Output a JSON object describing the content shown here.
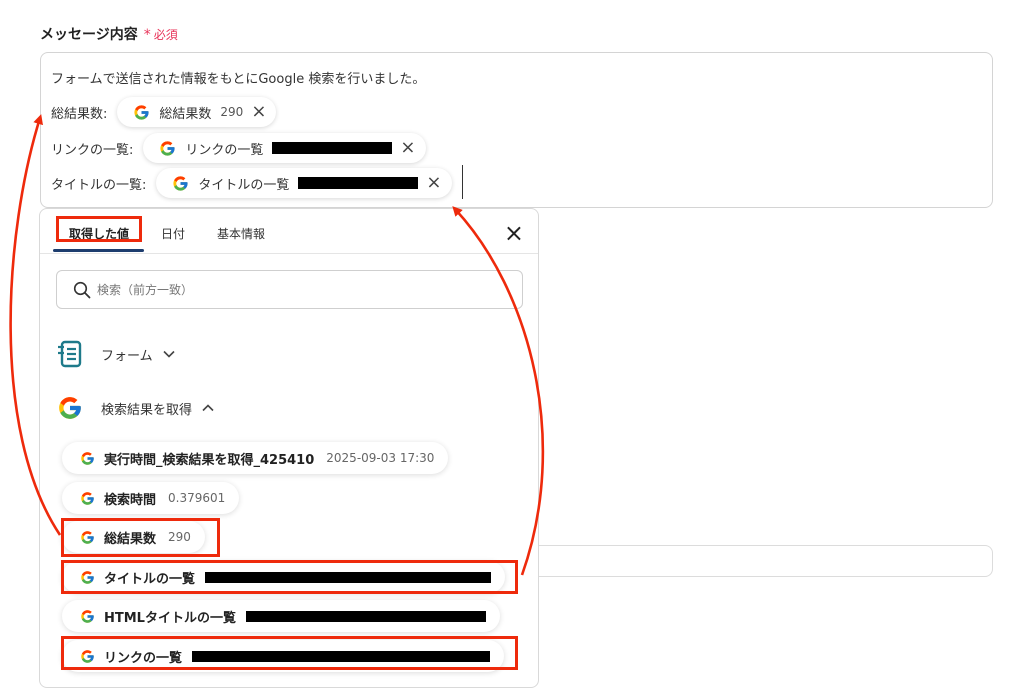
{
  "field": {
    "label": "メッセージ内容",
    "required_mark": "*",
    "required_text": "必須"
  },
  "message": {
    "line1": "フォームで送信された情報をもとにGoogle 検索を行いました。",
    "rows": [
      {
        "label": "総結果数:",
        "chip_label": "総結果数",
        "chip_value": "290"
      },
      {
        "label": "リンクの一覧:",
        "chip_label": "リンクの一覧",
        "chip_value": "[redacted]"
      },
      {
        "label": "タイトルの一覧:",
        "chip_label": "タイトルの一覧",
        "chip_value": "[redacted]"
      }
    ],
    "close_glyph": "×"
  },
  "panel": {
    "tabs": [
      {
        "label": "取得した値",
        "active": true
      },
      {
        "label": "日付",
        "active": false
      },
      {
        "label": "基本情報",
        "active": false
      }
    ],
    "close_glyph": "×",
    "search_placeholder": "検索（前方一致）",
    "sections": {
      "form": {
        "label": "フォーム",
        "chevron": "⌄"
      },
      "google": {
        "label": "検索結果を取得",
        "chevron": "^"
      }
    },
    "items": [
      {
        "label": "実行時間_検索結果を取得_425410",
        "value": "2025-09-03 17:30"
      },
      {
        "label": "検索時間",
        "value": "0.379601"
      },
      {
        "label": "総結果数",
        "value": "290"
      },
      {
        "label": "タイトルの一覧",
        "value": "[redacted]"
      },
      {
        "label": "HTMLタイトルの一覧",
        "value": "[redacted]"
      },
      {
        "label": "リンクの一覧",
        "value": "[redacted]"
      }
    ]
  },
  "colors": {
    "highlight": "#ee2a0c",
    "required": "#e8345a",
    "tab_underline": "#1d3d6e",
    "form_icon": "#1e7a8a"
  },
  "icons": [
    "google-icon",
    "close-icon",
    "search-icon",
    "form-icon",
    "chevron-down-icon",
    "chevron-up-icon"
  ]
}
